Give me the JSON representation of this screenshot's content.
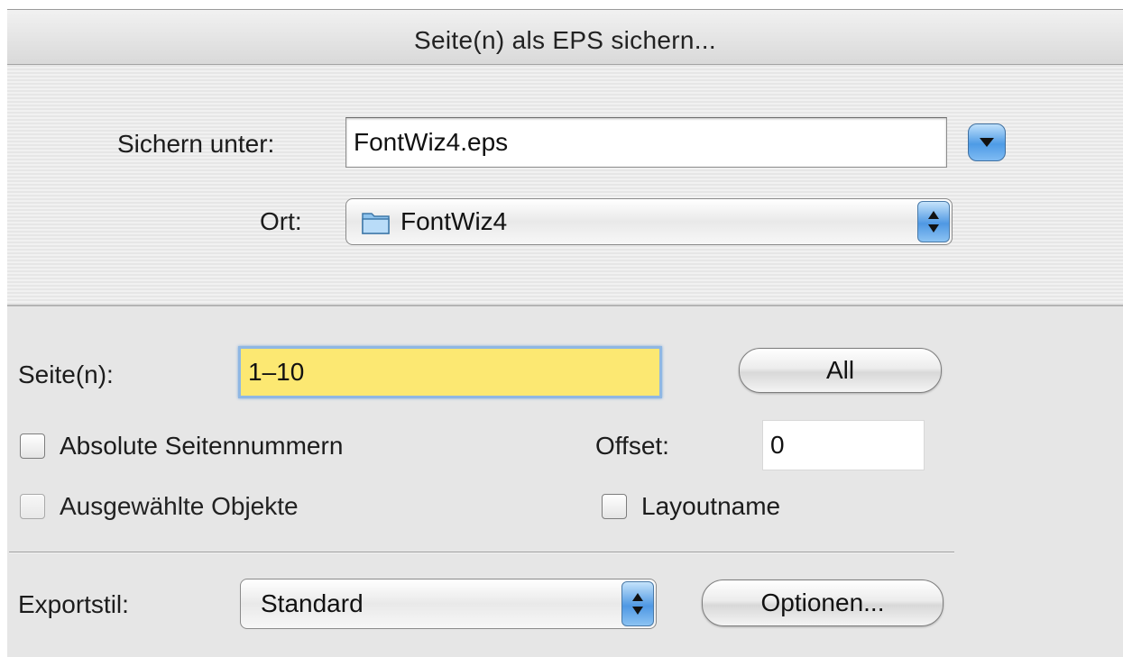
{
  "window": {
    "title": "Seite(n) als EPS sichern..."
  },
  "save": {
    "label": "Sichern unter:",
    "filename": "FontWiz4.eps"
  },
  "location": {
    "label": "Ort:",
    "value": "FontWiz4"
  },
  "pages": {
    "label": "Seite(n):",
    "value": "1–10",
    "all_button": "All"
  },
  "options": {
    "absolute_page_numbers": "Absolute Seitennummern",
    "offset_label": "Offset:",
    "offset_value": "0",
    "selected_objects": "Ausgewählte Objekte",
    "layout_name": "Layoutname"
  },
  "export": {
    "label": "Exportstil:",
    "style_value": "Standard",
    "options_button": "Optionen..."
  },
  "colors": {
    "page_field_highlight": "#fce872",
    "accent_blue": "#4e9be6"
  },
  "icons": {
    "disclosure": "chevron-down-icon",
    "popup": "up-down-arrows-icon",
    "folder": "folder-icon"
  }
}
